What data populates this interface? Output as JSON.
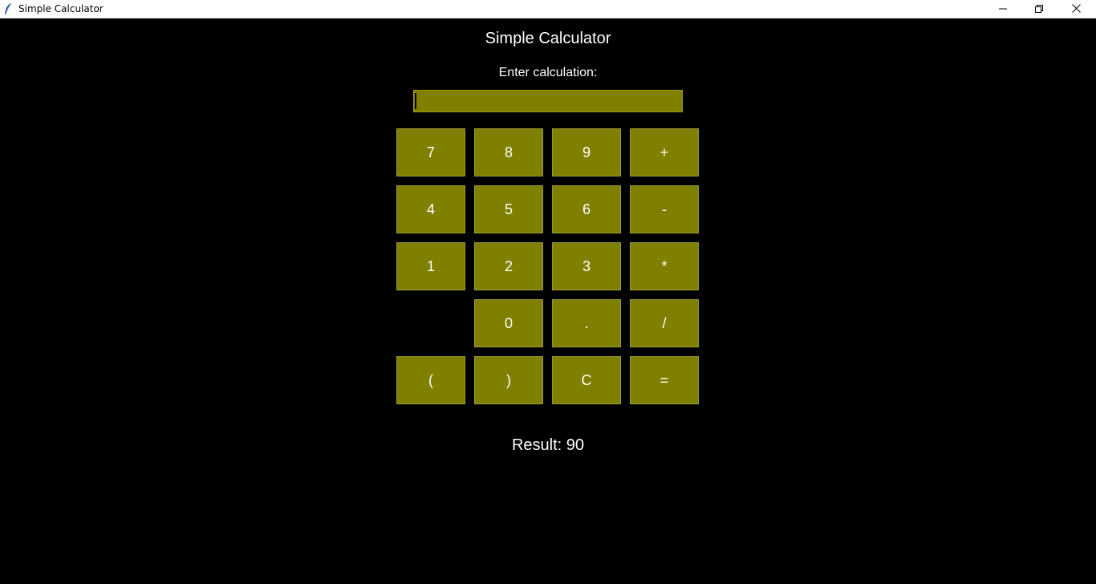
{
  "window": {
    "title": "Simple Calculator",
    "icon": "feather-icon",
    "controls": [
      "minimize-icon",
      "restore-icon",
      "close-icon"
    ]
  },
  "app": {
    "heading": "Simple Calculator",
    "prompt": "Enter calculation:",
    "entry_value": "",
    "result_text": "Result: 90"
  },
  "colors": {
    "background": "#000000",
    "button": "#808000",
    "text": "#ffffff"
  },
  "keypad": [
    [
      "7",
      "8",
      "9",
      "+"
    ],
    [
      "4",
      "5",
      "6",
      "-"
    ],
    [
      "1",
      "2",
      "3",
      "*"
    ],
    [
      "",
      "0",
      ".",
      "/"
    ],
    [
      "(",
      ")",
      "C",
      "="
    ]
  ]
}
